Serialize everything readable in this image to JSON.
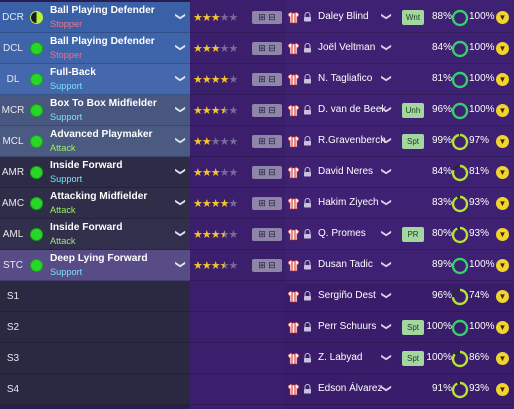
{
  "colors": {
    "support": "#7be0ff",
    "attack": "#9cf06b",
    "stopper": "#ff6f7f",
    "star": "#f4c52c",
    "condition_ring": "#35d06b",
    "sharp_ring": "#b6e33a",
    "status_badge": "#a4d6a0"
  },
  "rows": [
    {
      "position": "DCR",
      "role": "Ball Playing Defender",
      "duty": "Stopper",
      "duty_type": "stopper",
      "stars": 3,
      "half_star": false,
      "player": "Daley Blind",
      "status": "Wnt",
      "condition": "88%",
      "sharpness": "100%",
      "cond_val": 0.88,
      "sharp_val": 1.0,
      "bg": "#3a61a8",
      "dot": "half"
    },
    {
      "position": "DCL",
      "role": "Ball Playing Defender",
      "duty": "Stopper",
      "duty_type": "stopper",
      "stars": 3,
      "half_star": false,
      "player": "Joël Veltman",
      "status": "",
      "condition": "84%",
      "sharpness": "100%",
      "cond_val": 0.84,
      "sharp_val": 1.0,
      "bg": "#3e64a9",
      "dot": "full"
    },
    {
      "position": "DL",
      "role": "Full-Back",
      "duty": "Support",
      "duty_type": "support",
      "stars": 4,
      "half_star": false,
      "player": "N. Tagliafico",
      "status": "",
      "condition": "81%",
      "sharpness": "100%",
      "cond_val": 0.81,
      "sharp_val": 1.0,
      "bg": "#4468ab",
      "dot": "full"
    },
    {
      "position": "MCR",
      "role": "Box To Box Midfielder",
      "duty": "Support",
      "duty_type": "support",
      "stars": 3,
      "half_star": true,
      "player": "D. van de Beek",
      "status": "Unh",
      "condition": "96%",
      "sharpness": "100%",
      "cond_val": 0.96,
      "sharp_val": 1.0,
      "bg": "#47577f",
      "dot": "full"
    },
    {
      "position": "MCL",
      "role": "Advanced Playmaker",
      "duty": "Attack",
      "duty_type": "attack",
      "stars": 2,
      "half_star": false,
      "player": "R.Gravenberch",
      "status": "Spt",
      "condition": "99%",
      "sharpness": "97%",
      "cond_val": 0.99,
      "sharp_val": 0.97,
      "bg": "#4a5a80",
      "dot": "full"
    },
    {
      "position": "AMR",
      "role": "Inside Forward",
      "duty": "Support",
      "duty_type": "support",
      "stars": 3,
      "half_star": false,
      "player": "David Neres",
      "status": "",
      "condition": "84%",
      "sharpness": "81%",
      "cond_val": 0.84,
      "sharp_val": 0.81,
      "bg": "#2d2b45",
      "dot": "full"
    },
    {
      "position": "AMC",
      "role": "Attacking Midfielder",
      "duty": "Attack",
      "duty_type": "attack",
      "stars": 4,
      "half_star": false,
      "player": "Hakim Ziyech",
      "status": "",
      "condition": "83%",
      "sharpness": "93%",
      "cond_val": 0.83,
      "sharp_val": 0.93,
      "bg": "#2f2d48",
      "dot": "full"
    },
    {
      "position": "AML",
      "role": "Inside Forward",
      "duty": "Attack",
      "duty_type": "attack",
      "stars": 3,
      "half_star": true,
      "player": "Q. Promes",
      "status": "PR",
      "condition": "80%",
      "sharpness": "93%",
      "cond_val": 0.8,
      "sharp_val": 0.93,
      "bg": "#312f4b",
      "dot": "full"
    },
    {
      "position": "STC",
      "role": "Deep Lying Forward",
      "duty": "Support",
      "duty_type": "support",
      "stars": 3,
      "half_star": true,
      "player": "Dusan Tadic",
      "status": "",
      "condition": "89%",
      "sharpness": "100%",
      "cond_val": 0.89,
      "sharp_val": 1.0,
      "bg": "#574c86",
      "dot": "full"
    },
    {
      "position": "S1",
      "role": "",
      "duty": "",
      "duty_type": "",
      "stars": 0,
      "half_star": false,
      "player": "Sergiño Dest",
      "status": "",
      "condition": "96%",
      "sharpness": "74%",
      "cond_val": 0.96,
      "sharp_val": 0.74,
      "bg": "#2b2942",
      "dot": "none"
    },
    {
      "position": "S2",
      "role": "",
      "duty": "",
      "duty_type": "",
      "stars": 0,
      "half_star": false,
      "player": "Perr Schuurs",
      "status": "Spt",
      "condition": "100%",
      "sharpness": "100%",
      "cond_val": 1.0,
      "sharp_val": 1.0,
      "bg": "#2b2942",
      "dot": "none"
    },
    {
      "position": "S3",
      "role": "",
      "duty": "",
      "duty_type": "",
      "stars": 0,
      "half_star": false,
      "player": "Z. Labyad",
      "status": "Spt",
      "condition": "100%",
      "sharpness": "86%",
      "cond_val": 1.0,
      "sharp_val": 0.86,
      "bg": "#2b2942",
      "dot": "none"
    },
    {
      "position": "S4",
      "role": "",
      "duty": "",
      "duty_type": "",
      "stars": 0,
      "half_star": false,
      "player": "Edson Álvarez",
      "status": "",
      "condition": "91%",
      "sharpness": "93%",
      "cond_val": 0.91,
      "sharp_val": 0.93,
      "bg": "#2b2942",
      "dot": "none"
    }
  ],
  "icons": {
    "role_dropdown": "chevron-down-icon",
    "player_dropdown": "chevron-down-icon",
    "shirt": "team-shirt-icon",
    "pin": "player-pin-icon",
    "instructions": "player-instructions-icon",
    "morale": "morale-arrow-icon"
  }
}
